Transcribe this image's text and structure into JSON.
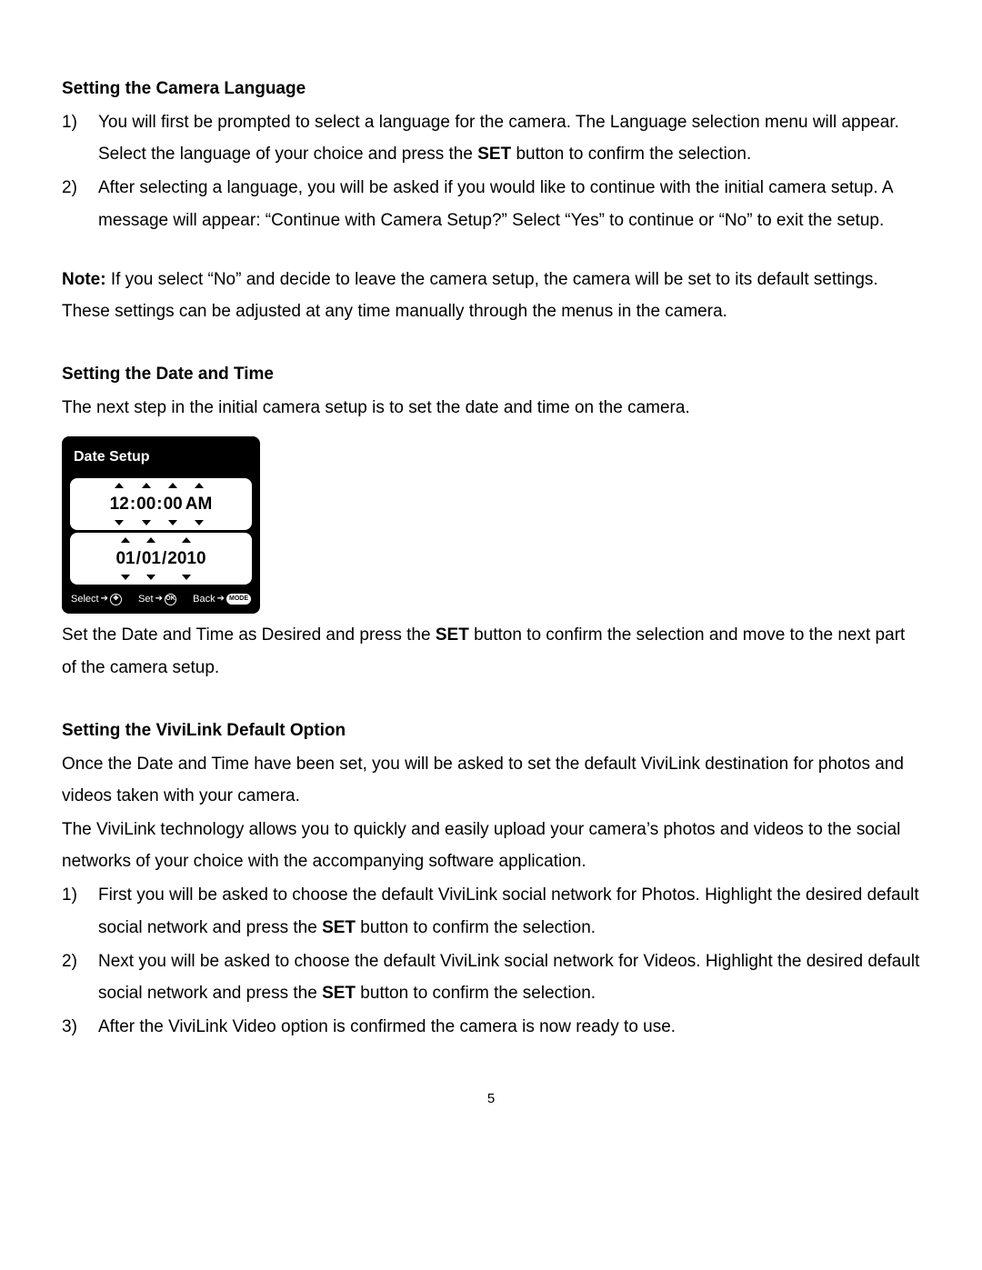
{
  "section1": {
    "heading": "Setting the Camera Language",
    "items": [
      {
        "num": "1)",
        "text_a": "You will first be prompted to select a language for the camera. The Language selection menu will appear. Select the language of your choice and press the ",
        "bold": "SET",
        "text_b": " button to confirm the selection."
      },
      {
        "num": "2)",
        "text_a": "After selecting a language, you will be asked if you would like to continue with the initial camera setup. A message will appear: “Continue with Camera Setup?” Select “Yes” to continue or “No” to exit the setup.",
        "bold": "",
        "text_b": ""
      }
    ],
    "note_label": "Note:",
    "note_text": " If you select “No” and decide to leave the camera setup, the camera will be set to its default settings. These settings can be adjusted at any time manually through the menus in the camera."
  },
  "section2": {
    "heading": "Setting the Date and Time",
    "intro": "The next step in the initial camera setup is to set the date and time on the camera.",
    "box": {
      "title": "Date Setup",
      "time": {
        "h": "12",
        "m": "00",
        "s": "00",
        "ampm": "AM"
      },
      "date": {
        "mm": "01",
        "dd": "01",
        "yyyy": "2010"
      },
      "footer": {
        "select": "Select",
        "set": "Set",
        "back": "Back",
        "nav_icon": "✥",
        "ok_icon": "OK",
        "mode_icon": "MODE"
      }
    },
    "after_a": "Set the Date and Time as Desired and press the ",
    "after_bold": "SET",
    "after_b": " button to confirm the selection and move to the next part of the camera setup."
  },
  "section3": {
    "heading": "Setting the ViviLink Default Option",
    "intro1": "Once the Date and Time have been set, you will be asked to set the default ViviLink destination for photos and videos taken with your camera.",
    "intro2": "The ViviLink technology allows you to quickly and easily upload your camera’s photos and videos to the social networks of your choice with the accompanying software application.",
    "items": [
      {
        "num": "1)",
        "text_a": "First you will be asked to choose the default ViviLink social network for Photos. Highlight the desired default social network and press the ",
        "bold": "SET",
        "text_b": " button to confirm the selection."
      },
      {
        "num": "2)",
        "text_a": "Next you will be asked to choose the default ViviLink social network for Videos. Highlight the desired default social network and press the ",
        "bold": "SET",
        "text_b": " button to confirm the selection."
      },
      {
        "num": "3)",
        "text_a": "After the ViviLink Video option is confirmed the camera is now ready to use.",
        "bold": "",
        "text_b": ""
      }
    ]
  },
  "page_number": "5"
}
